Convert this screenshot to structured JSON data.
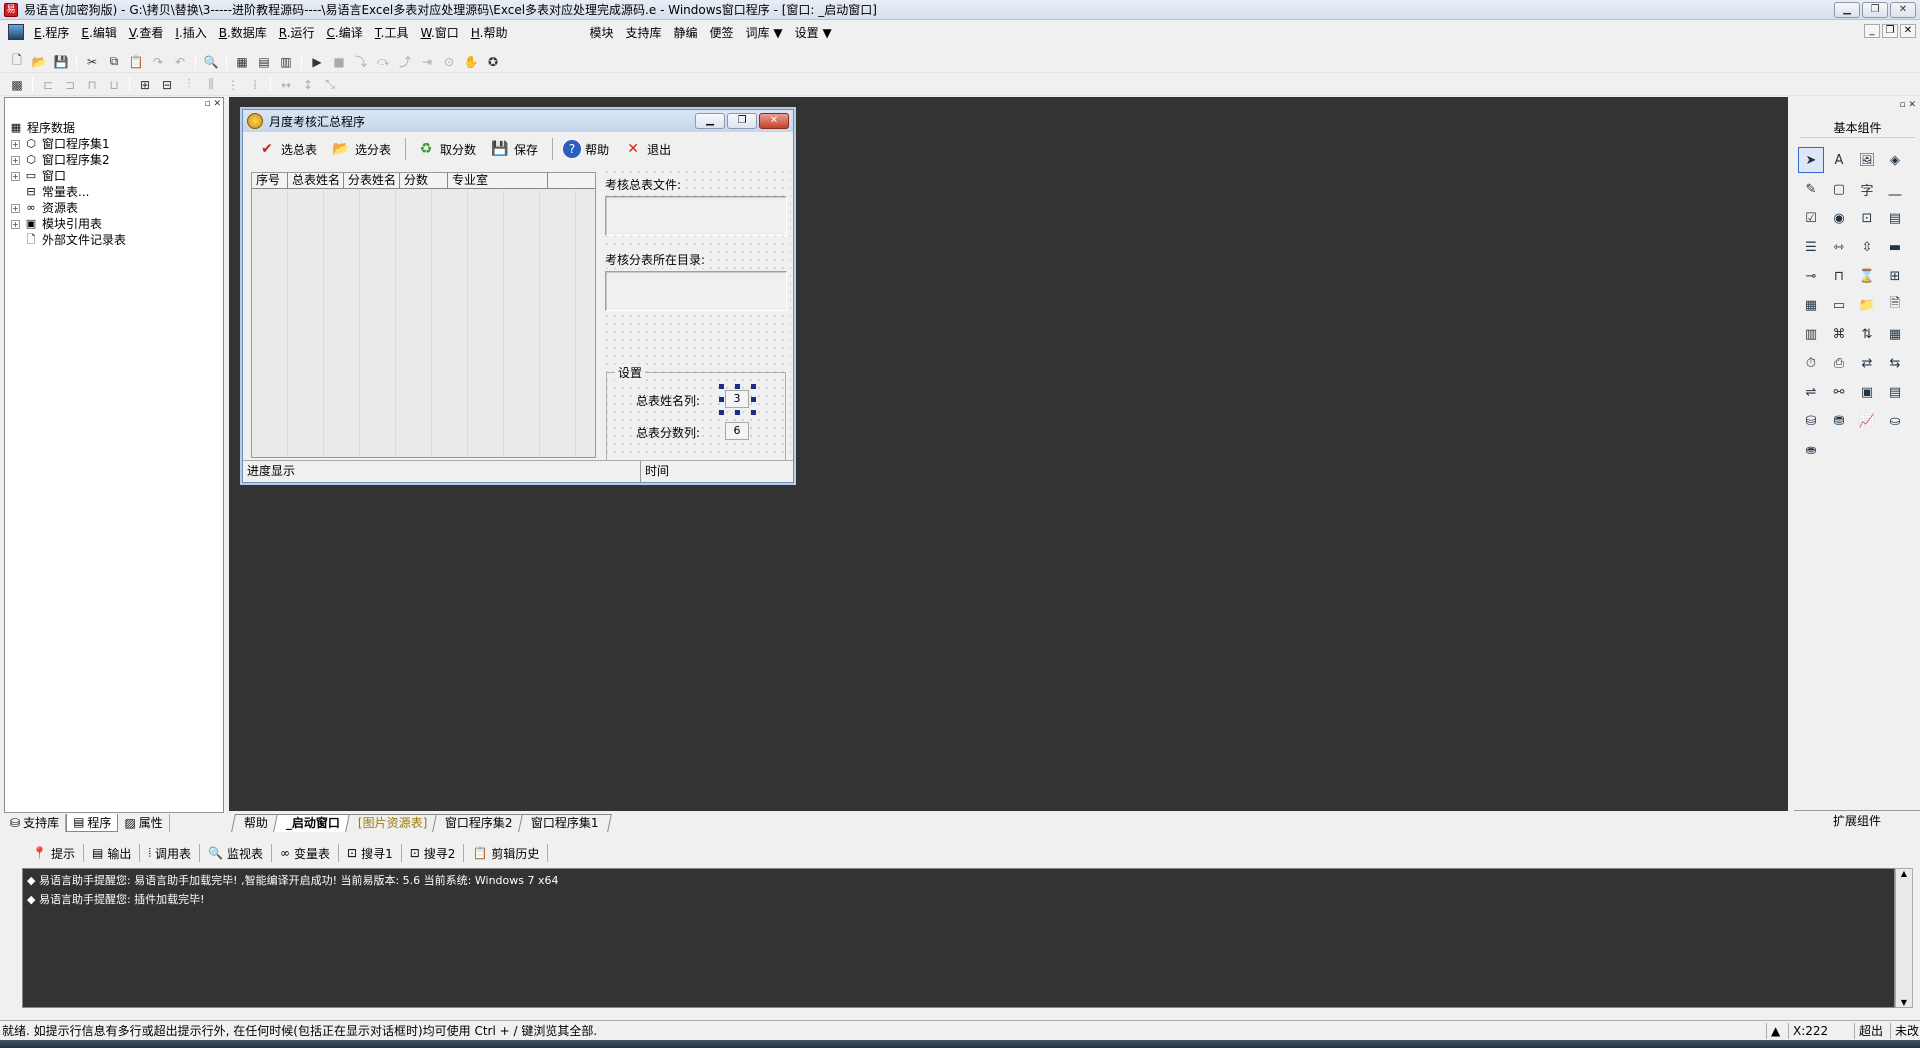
{
  "app": {
    "title": "易语言(加密狗版) - G:\\拷贝\\替换\\3-----进阶教程源码----\\易语言Excel多表对应处理源码\\Excel多表对应处理完成源码.e - Windows窗口程序 - [窗口: _启动窗口]"
  },
  "menu": {
    "items": [
      {
        "key": "E",
        "label": ".程序"
      },
      {
        "key": "E",
        "label": ".编辑"
      },
      {
        "key": "V",
        "label": ".查看"
      },
      {
        "key": "I",
        "label": ".插入"
      },
      {
        "key": "B",
        "label": ".数据库"
      },
      {
        "key": "R",
        "label": ".运行"
      },
      {
        "key": "C",
        "label": ".编译"
      },
      {
        "key": "T",
        "label": ".工具"
      },
      {
        "key": "W",
        "label": ".窗口"
      },
      {
        "key": "H",
        "label": ".帮助"
      }
    ],
    "extra": [
      "模块",
      "支持库",
      "静编",
      "便签",
      "词库",
      "设置"
    ]
  },
  "tree": {
    "root": "程序数据",
    "items": [
      "窗口程序集1",
      "窗口程序集2",
      "窗口",
      "常量表...",
      "资源表",
      "模块引用表",
      "外部文件记录表"
    ]
  },
  "left_tabs": [
    "支持库",
    "程序",
    "属性"
  ],
  "form": {
    "title": "月度考核汇总程序",
    "toolbar": [
      "选总表",
      "选分表",
      "取分数",
      "保存",
      "帮助",
      "退出"
    ],
    "list_columns": [
      "序号",
      "总表姓名",
      "分表姓名",
      "分数",
      "专业室"
    ],
    "label_total_file": "考核总表文件:",
    "label_sub_dir": "考核分表所在目录:",
    "group_title": "设置",
    "label_name_col": "总表姓名列:",
    "name_col_value": "3",
    "label_score_col": "总表分数列:",
    "score_col_value": "6",
    "status_progress": "进度显示",
    "status_time": "时间"
  },
  "toolbox": {
    "title": "基本组件",
    "footer": "扩展组件"
  },
  "workspace_tabs": [
    "帮助",
    "_启动窗口",
    "[图片资源表]",
    "窗口程序集2",
    "窗口程序集1"
  ],
  "output_tabs": [
    "提示",
    "输出",
    "调用表",
    "监视表",
    "变量表",
    "搜寻1",
    "搜寻2",
    "剪辑历史"
  ],
  "output_lines": [
    "易语言助手提醒您: 易语言助手加载完毕! ,智能编译开启成功! 当前易版本: 5.6  当前系统: Windows 7 x64",
    "易语言助手提醒您: 插件加载完毕!"
  ],
  "status": {
    "text": "就绪. 如提示行信息有多行或超出提示行外, 在任何时候(包括正在显示对话框时)均可使用 Ctrl + / 键浏览其全部.",
    "coord": "X:222",
    "mode": "超出",
    "state": "未改"
  }
}
